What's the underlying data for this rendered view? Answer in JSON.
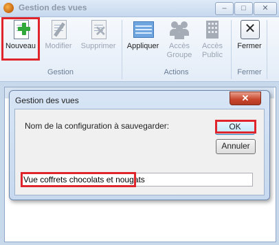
{
  "window": {
    "title": "Gestion des vues",
    "controls": {
      "minimize": "–",
      "maximize": "□",
      "close": "✕"
    }
  },
  "ribbon": {
    "groups": [
      {
        "label": "Gestion",
        "buttons": [
          {
            "label": "Nouveau",
            "icon": "new-document-icon",
            "enabled": true
          },
          {
            "label": "Modifier",
            "icon": "edit-document-icon",
            "enabled": false
          },
          {
            "label": "Supprimer",
            "icon": "delete-document-icon",
            "enabled": false
          }
        ]
      },
      {
        "label": "Actions",
        "buttons": [
          {
            "label": "Appliquer",
            "icon": "apply-view-icon",
            "enabled": true
          },
          {
            "label": "Accès Groupe",
            "icon": "group-access-icon",
            "enabled": false
          },
          {
            "label": "Accès Public",
            "icon": "public-access-icon",
            "enabled": false
          }
        ]
      },
      {
        "label": "Fermer",
        "buttons": [
          {
            "label": "Fermer",
            "icon": "close-icon",
            "enabled": true
          }
        ]
      }
    ]
  },
  "dialog": {
    "title": "Gestion des vues",
    "close_glyph": "✕",
    "prompt": "Nom de la configuration à sauvegarder:",
    "ok_label": "OK",
    "cancel_label": "Annuler",
    "name_value": "Vue coffrets chocolats et nougats"
  },
  "colors": {
    "highlight": "#e0242b",
    "ribbon_bg": "#e3ecf7",
    "accent_green": "#31a83a"
  }
}
